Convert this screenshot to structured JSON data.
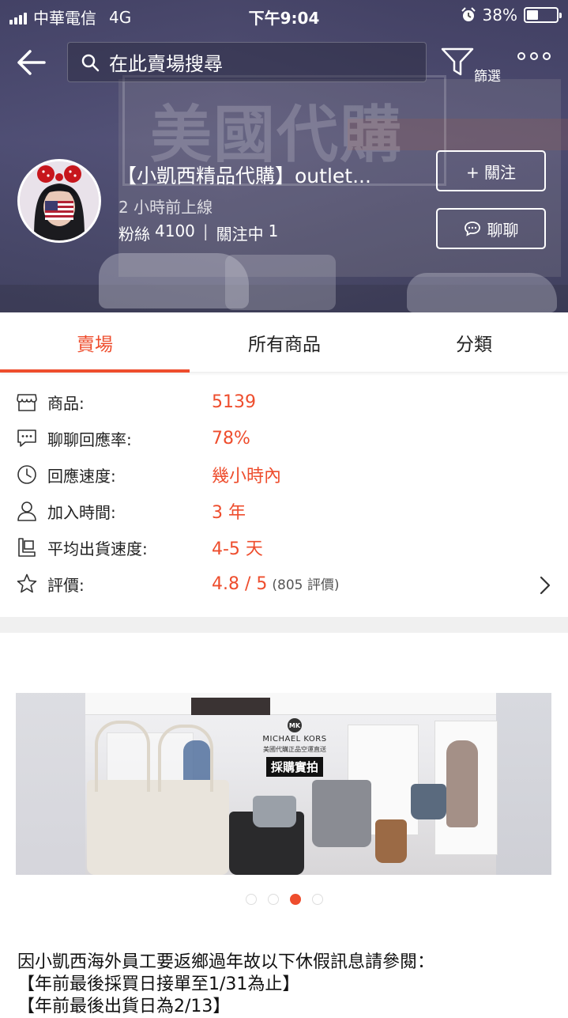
{
  "status_bar": {
    "carrier": "中華電信",
    "network": "4G",
    "time": "下午9:04",
    "battery_percent": "38%",
    "battery_level": 0.38
  },
  "header": {
    "search_placeholder": "在此賣場搜尋",
    "filter_label": "篩選",
    "banner_watermark": "美國代購"
  },
  "shop": {
    "name": "【小凱西精品代購】outlet...",
    "last_online": "2 小時前上線",
    "followers_label": "粉絲",
    "followers_count": "4100",
    "following_label": "關注中",
    "following_count": "1",
    "follow_button": "+ 關注",
    "chat_button": "聊聊"
  },
  "tabs": [
    {
      "label": "賣場",
      "active": true
    },
    {
      "label": "所有商品",
      "active": false
    },
    {
      "label": "分類",
      "active": false
    }
  ],
  "stats": [
    {
      "icon": "store-icon",
      "label": "商品:",
      "value": "5139"
    },
    {
      "icon": "chat-bubble-icon",
      "label": "聊聊回應率:",
      "value": "78%"
    },
    {
      "icon": "clock-icon",
      "label": "回應速度:",
      "value": "幾小時內"
    },
    {
      "icon": "user-icon",
      "label": "加入時間:",
      "value": "3 年"
    },
    {
      "icon": "shipping-box-icon",
      "label": "平均出貨速度:",
      "value": "4-5 天"
    },
    {
      "icon": "star-icon",
      "label": "評價:",
      "value": "4.8 / 5",
      "extra": "(805 評價)"
    }
  ],
  "carousel": {
    "brand": "MICHAEL KORS",
    "logo_text": "MK",
    "subtitle": "美國代購正品空運直送",
    "tag": "採購實拍",
    "slide_count": 4,
    "active_index": 2
  },
  "notice": {
    "lines": [
      "因小凱西海外員工要返鄉過年故以下休假訊息請參閱：",
      "【年前最後採買日接單至1/31為止】",
      "【年前最後出貨日為2/13】"
    ]
  },
  "colors": {
    "accent": "#ee4d2d",
    "banner_overlay": "#3c3a5f",
    "divider": "#f0f0f0"
  }
}
